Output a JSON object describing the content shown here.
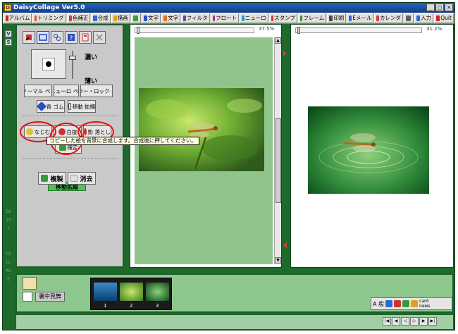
{
  "window": {
    "title": "DaisyCollage Ver5.0",
    "minimize": "_",
    "maximize": "□",
    "close": "×"
  },
  "toolbar": [
    {
      "label": "アルバム",
      "icon": "album-icon",
      "color": "#c02828"
    },
    {
      "label": "トリミング",
      "icon": "scissors-icon",
      "color": "#e05a1a"
    },
    {
      "label": "色補正",
      "icon": "palette-icon",
      "color": "#d93a3a"
    },
    {
      "label": "合成",
      "icon": "layers-icon",
      "color": "#2a6ad6"
    },
    {
      "label": "描画",
      "icon": "brush-icon",
      "color": "#e0a020"
    },
    {
      "label": "",
      "icon": "image-icon",
      "color": "#3aa040"
    },
    {
      "label": "文字",
      "icon": "text-icon",
      "color": "#2a4ec0"
    },
    {
      "label": "文字",
      "icon": "text-icon",
      "color": "#e07020"
    },
    {
      "label": "フィルタ",
      "icon": "filter-icon",
      "color": "#6a3ad0"
    },
    {
      "label": "フロート",
      "icon": "float-icon",
      "color": "#c02888"
    },
    {
      "label": "ニューロ",
      "icon": "neuro-icon",
      "color": "#2a9ad0"
    },
    {
      "label": "スタンプ",
      "icon": "stamp-icon",
      "color": "#d03a2a"
    },
    {
      "label": "フレーム",
      "icon": "frame-icon",
      "color": "#3a8a3a"
    },
    {
      "label": "印刷",
      "icon": "print-icon",
      "color": "#4a4a4a"
    },
    {
      "label": "Eメール",
      "icon": "mail-icon",
      "color": "#2a6ad6"
    },
    {
      "label": "カレンダ",
      "icon": "calendar-icon",
      "color": "#d04040"
    },
    {
      "label": "",
      "icon": "settings-icon",
      "color": "#606060"
    },
    {
      "label": "入力",
      "icon": "input-icon",
      "color": "#2a6ad6"
    },
    {
      "label": "Quit",
      "icon": "quit-arrow-icon",
      "color": "#d02020"
    }
  ],
  "side": {
    "btn_v": "V",
    "btn_s": "S",
    "vtext1": "DAISY",
    "vtext2": "COLLAGE"
  },
  "left_panel": {
    "dark_label": "濃い",
    "light_label": "薄い",
    "mode_normal": "ノーマル ペン",
    "mode_neuro": "ニューロ ペン",
    "mode_color_lock": "カラー・ロック ペン",
    "eraser_label": "青 ゴム",
    "move_label": "移動 拡縮",
    "smooth_label": "なじむ",
    "white_label": "白抜",
    "shadow_label": "影 落とし",
    "confirm_label": "確定",
    "move_scale_title": "移動拡縮",
    "copy_label": "複製",
    "delete_label": "消去"
  },
  "tooltip": "コピーした絵を背景に合成します。合成後に押してください。",
  "panel1": {
    "zoom": "37.5%"
  },
  "panel2": {
    "zoom": "31.2%"
  },
  "bottom": {
    "album_label": "暑中見舞",
    "film_numbers": [
      "1",
      "2",
      "3"
    ],
    "card_label": "card news",
    "iconrow_text": "A 般"
  }
}
